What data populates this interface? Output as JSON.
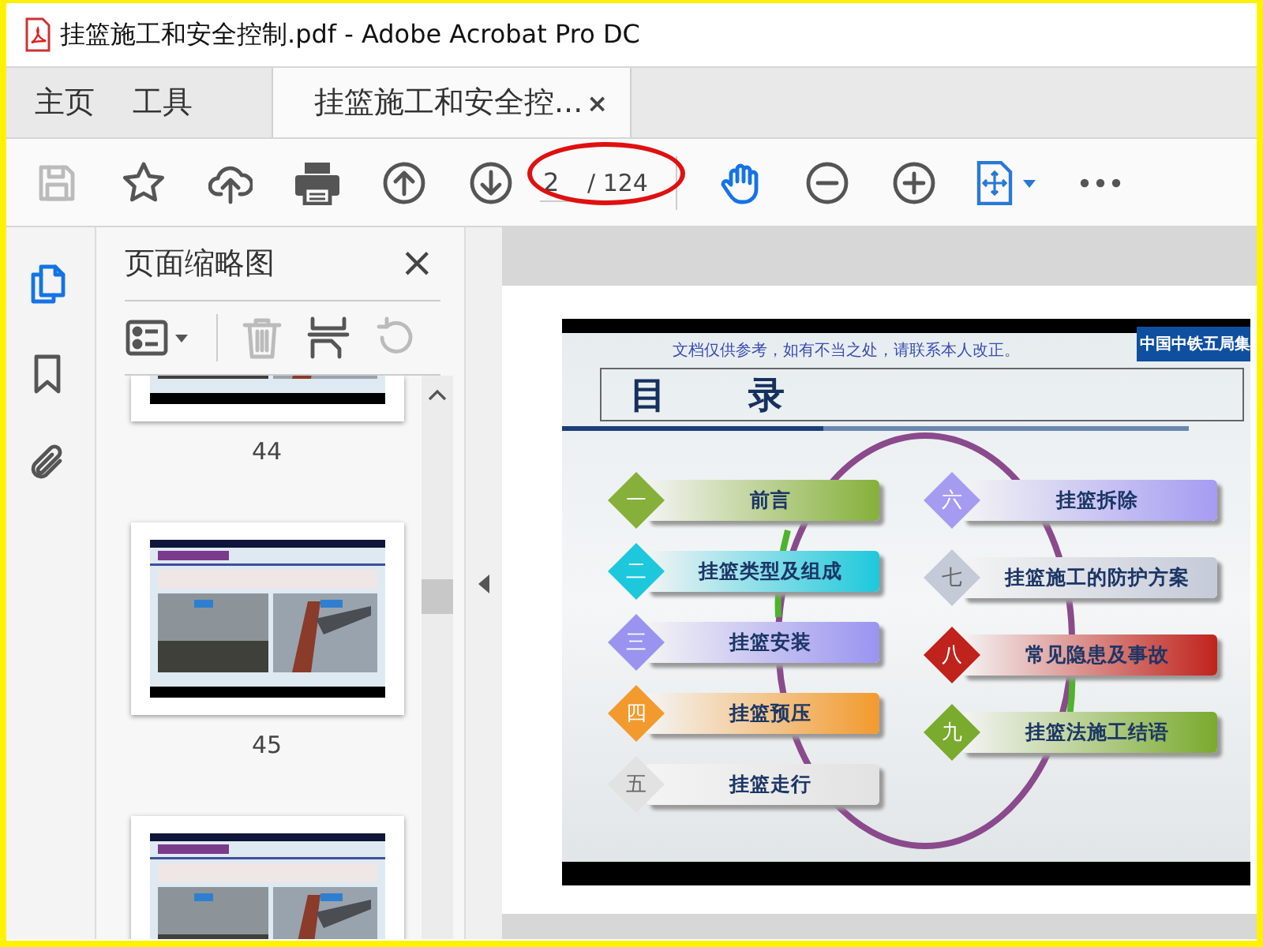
{
  "window": {
    "title": "挂篮施工和安全控制.pdf - Adobe Acrobat Pro DC"
  },
  "tabs": [
    {
      "label": "主页",
      "kind": "nav",
      "selected": false
    },
    {
      "label": "工具",
      "kind": "nav",
      "selected": false
    },
    {
      "label": "挂篮施工和安全控...",
      "kind": "document",
      "selected": true,
      "close": "×"
    }
  ],
  "toolbar": {
    "tools_left": [
      {
        "kind": "save",
        "disabled": true
      },
      {
        "kind": "star",
        "disabled": false
      },
      {
        "kind": "upload",
        "disabled": false
      },
      {
        "kind": "print",
        "disabled": false
      },
      {
        "kind": "prev",
        "disabled": false
      },
      {
        "kind": "next",
        "disabled": false
      }
    ],
    "page_field": {
      "value": "2",
      "total": "/ 124",
      "circled": true
    },
    "tools_right": [
      {
        "kind": "hand",
        "selected": true
      },
      {
        "kind": "zoom_out",
        "selected": false
      },
      {
        "kind": "zoom_in",
        "selected": false
      },
      {
        "kind": "fit",
        "selected": false
      },
      {
        "kind": "more",
        "selected": false
      }
    ]
  },
  "rail": [
    {
      "kind": "pages",
      "selected": true
    },
    {
      "kind": "bookmarks",
      "selected": false
    },
    {
      "kind": "attachments",
      "selected": false
    }
  ],
  "panel": {
    "title": "页面缩略图",
    "close": "×",
    "tools": [
      {
        "kind": "options",
        "disabled": false
      },
      {
        "kind": "delete",
        "disabled": true
      },
      {
        "kind": "insert",
        "disabled": false
      },
      {
        "kind": "undo",
        "disabled": true
      }
    ],
    "thumbnails": [
      {
        "kind": "picture",
        "label": "44"
      },
      {
        "kind": "picture",
        "label": "45"
      },
      {
        "kind": "picture"
      }
    ]
  },
  "slide": {
    "notice": "文档仅供参考，如有不当之处，请联系本人改正。",
    "logo": "中国中铁五局集",
    "heading": [
      "目",
      "录"
    ],
    "left_items": [
      {
        "numeral": "一",
        "label": "前言",
        "color": "#86b03a"
      },
      {
        "numeral": "二",
        "label": "挂篮类型及组成",
        "color": "#1ec8dc"
      },
      {
        "numeral": "三",
        "label": "挂篮安装",
        "color": "#9a94f0"
      },
      {
        "numeral": "四",
        "label": "挂篮预压",
        "color": "#f29a2e"
      },
      {
        "numeral": "五",
        "label": "挂篮走行",
        "color": "#e2e2e2"
      }
    ],
    "right_items": [
      {
        "numeral": "六",
        "label": "挂篮拆除",
        "color": "#a59cf2"
      },
      {
        "numeral": "七",
        "label": "挂篮施工的防护方案",
        "color": "#c5cad8"
      },
      {
        "numeral": "八",
        "label": "常见隐患及事故",
        "color": "#c0231c"
      },
      {
        "numeral": "九",
        "label": "挂篮法施工结语",
        "color": "#7aaa2e"
      }
    ]
  }
}
